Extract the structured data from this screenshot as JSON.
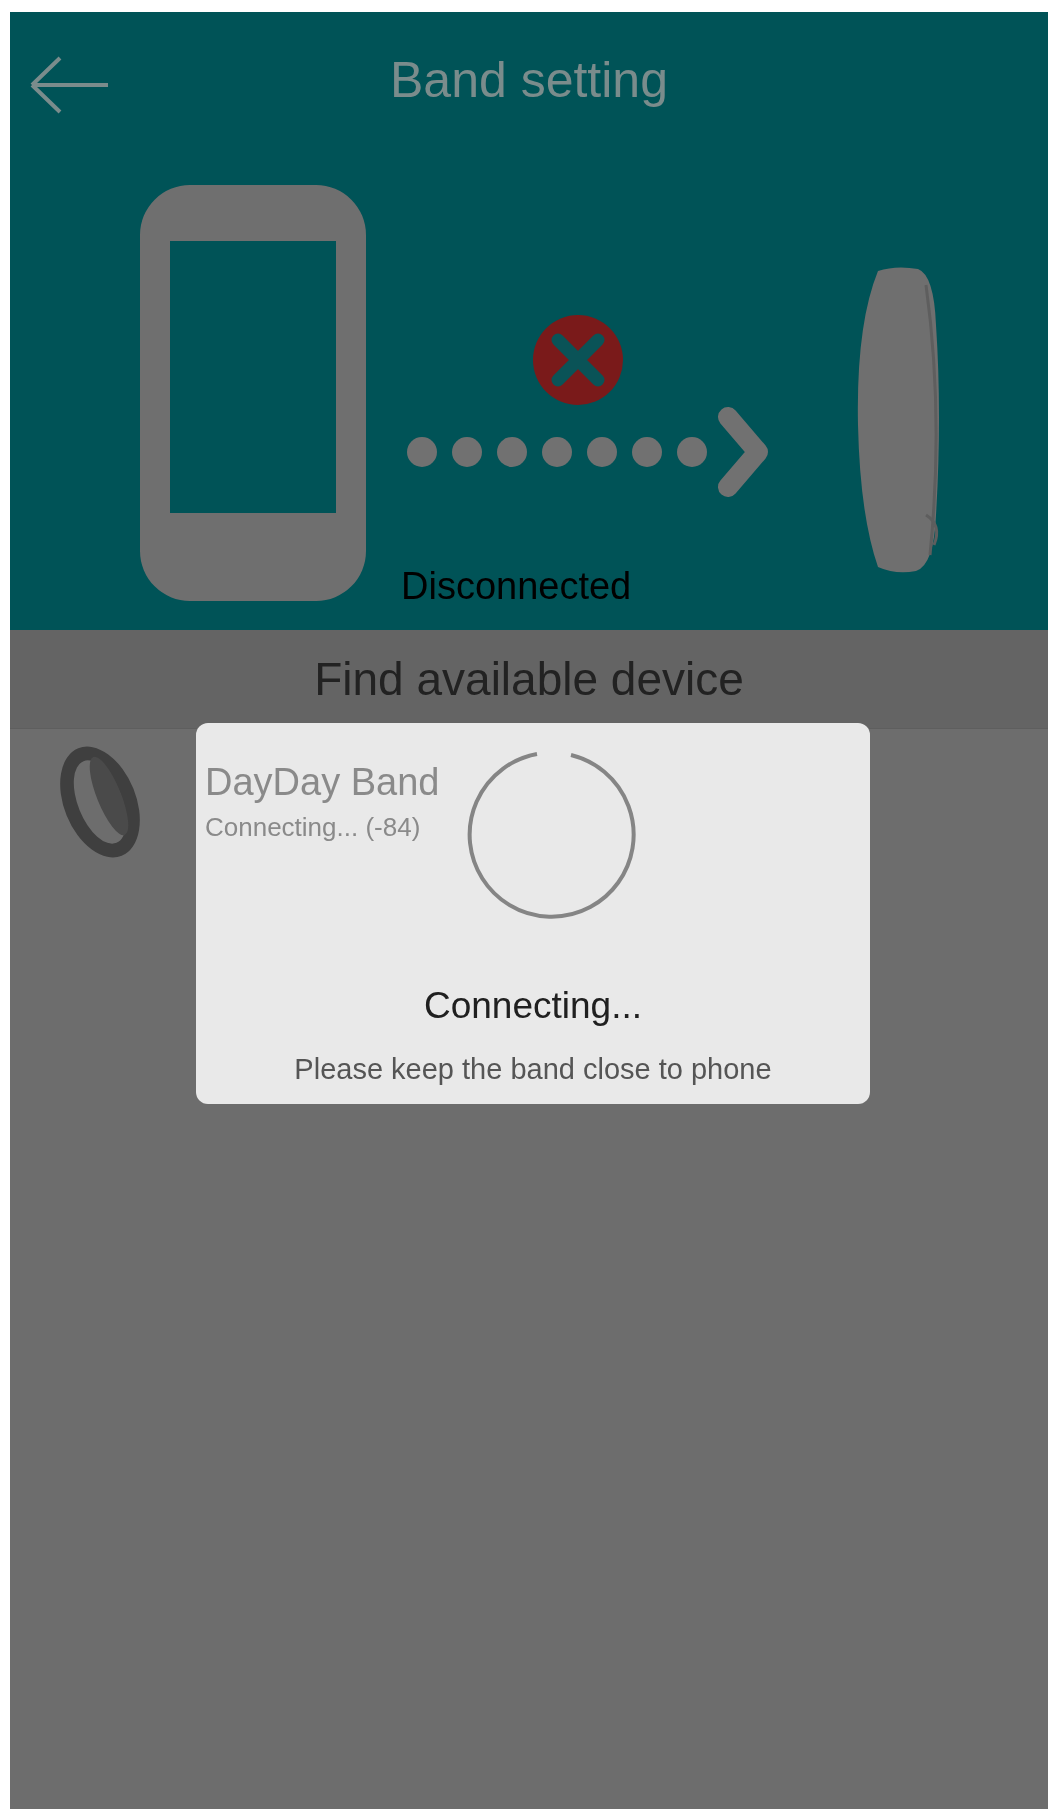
{
  "header": {
    "title": "Band setting"
  },
  "connection": {
    "status": "Disconnected",
    "connected": false
  },
  "section_title": "Find available device",
  "devices": [
    {
      "name": "DayDay Band",
      "status": "Connecting... (-84)"
    }
  ],
  "dialog": {
    "title": "Connecting...",
    "message": "Please keep the band close to phone"
  }
}
